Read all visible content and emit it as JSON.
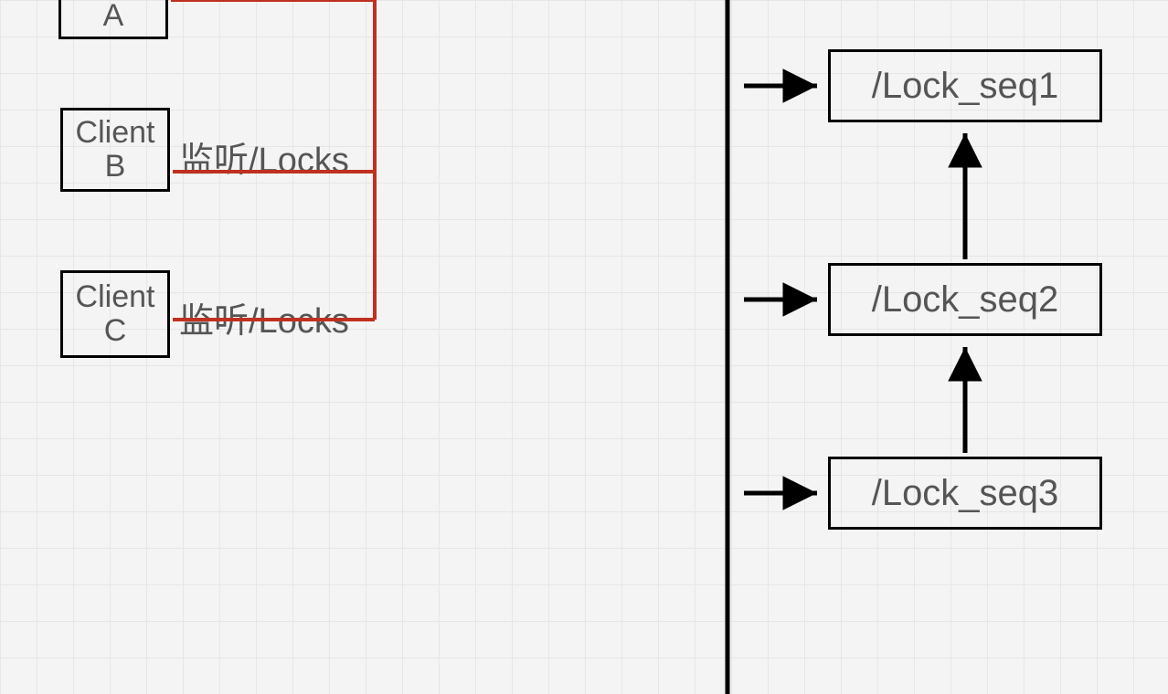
{
  "clients": {
    "a": {
      "label": "ClientA"
    },
    "b": {
      "label": "ClientB",
      "edge_label": "监听/Locks"
    },
    "c": {
      "label": "ClientC",
      "edge_label": "监听/Locks"
    }
  },
  "locks": {
    "s1": {
      "label": "/Lock_seq1"
    },
    "s2": {
      "label": "/Lock_seq2"
    },
    "s3": {
      "label": "/Lock_seq3"
    }
  }
}
